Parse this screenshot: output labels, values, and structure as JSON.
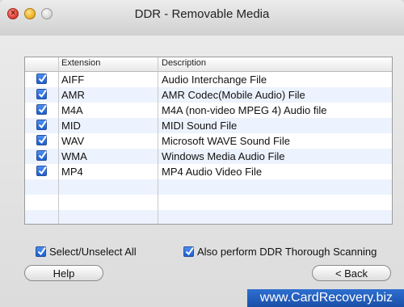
{
  "window": {
    "title": "DDR - Removable Media"
  },
  "table": {
    "columns": {
      "extension": "Extension",
      "description": "Description"
    },
    "rows": [
      {
        "checked": true,
        "extension": "AIFF",
        "description": "Audio Interchange File"
      },
      {
        "checked": true,
        "extension": "AMR",
        "description": "AMR Codec(Mobile Audio) File"
      },
      {
        "checked": true,
        "extension": "M4A",
        "description": "M4A (non-video MPEG 4) Audio file"
      },
      {
        "checked": true,
        "extension": "MID",
        "description": "MIDI Sound File"
      },
      {
        "checked": true,
        "extension": "WAV",
        "description": "Microsoft WAVE Sound File"
      },
      {
        "checked": true,
        "extension": "WMA",
        "description": "Windows Media Audio File"
      },
      {
        "checked": true,
        "extension": "MP4",
        "description": "MP4 Audio Video File"
      }
    ]
  },
  "options": {
    "select_all_label": "Select/Unselect All",
    "thorough_label": "Also perform DDR Thorough Scanning"
  },
  "buttons": {
    "help": "Help",
    "back": "< Back"
  },
  "watermark": "www.CardRecovery.biz",
  "colors": {
    "accent": "#1c5fd1",
    "badge": "#1b4fa8",
    "row_alt": "#edf3fe"
  }
}
